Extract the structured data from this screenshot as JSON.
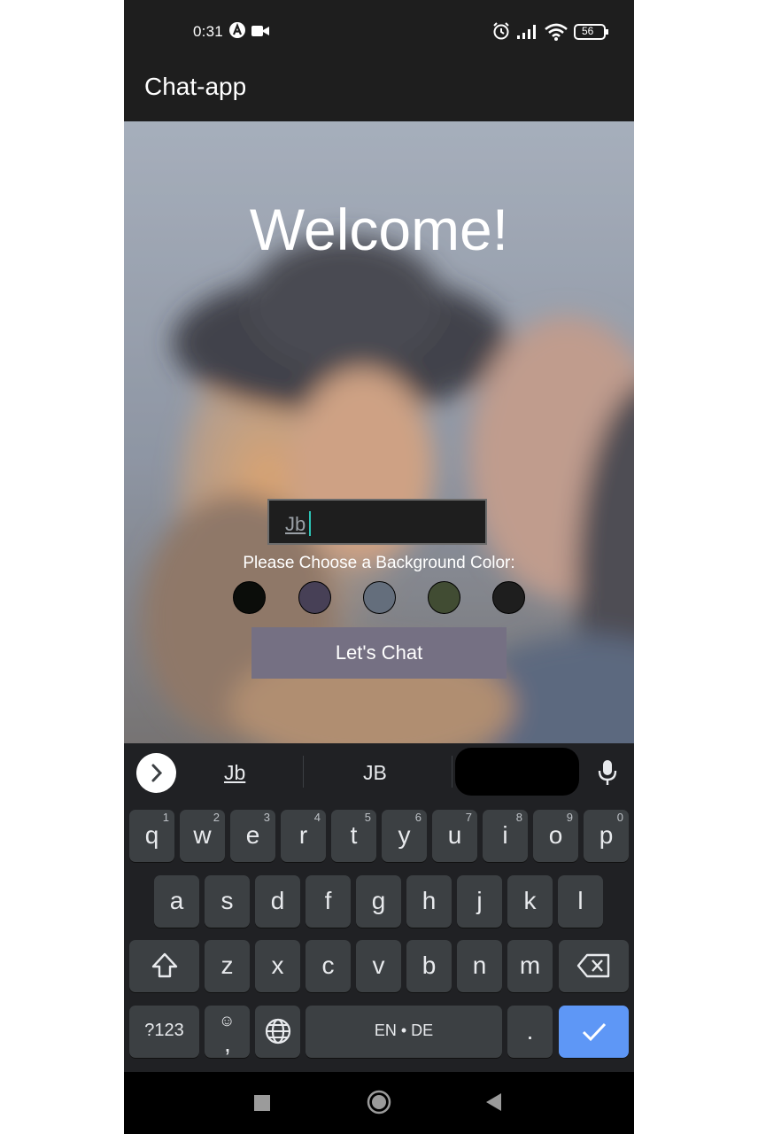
{
  "status_bar": {
    "time": "0:31",
    "battery": "56",
    "icons": [
      "location-a-icon",
      "video-icon",
      "alarm-icon",
      "signal-icon",
      "wifi-icon",
      "battery-icon"
    ]
  },
  "app_bar": {
    "title": "Chat-app"
  },
  "start_screen": {
    "welcome": "Welcome!",
    "name_input": {
      "value": "Jb"
    },
    "choose_label": "Please Choose a Background Color:",
    "colors": [
      "#090C08",
      "#474056",
      "#8A95A5",
      "#B9C6AE",
      "#1e1e1e"
    ],
    "chat_button": "Let's Chat",
    "button_color": "#757083"
  },
  "keyboard": {
    "suggestions": [
      "Jb",
      "JB"
    ],
    "row1": [
      {
        "k": "q",
        "h": "1"
      },
      {
        "k": "w",
        "h": "2"
      },
      {
        "k": "e",
        "h": "3"
      },
      {
        "k": "r",
        "h": "4"
      },
      {
        "k": "t",
        "h": "5"
      },
      {
        "k": "y",
        "h": "6"
      },
      {
        "k": "u",
        "h": "7"
      },
      {
        "k": "i",
        "h": "8"
      },
      {
        "k": "o",
        "h": "9"
      },
      {
        "k": "p",
        "h": "0"
      }
    ],
    "row2": [
      "a",
      "s",
      "d",
      "f",
      "g",
      "h",
      "j",
      "k",
      "l"
    ],
    "row3": [
      "z",
      "x",
      "c",
      "v",
      "b",
      "n",
      "m"
    ],
    "symbols_label": "?123",
    "emoji_label": ",",
    "space_label": "EN • DE",
    "period_label": "."
  },
  "nav_bar": {
    "icons": [
      "recents-icon",
      "home-icon",
      "back-icon"
    ]
  }
}
